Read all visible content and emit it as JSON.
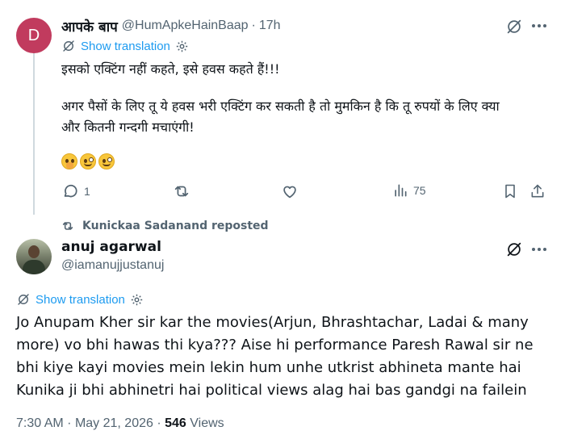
{
  "tweet1": {
    "avatar_initial": "D",
    "avatar_color": "#c13b5e",
    "name": "आपके बाप",
    "handle": "@HumApkeHainBaap",
    "separator": "·",
    "time": "17h",
    "show_translation": "Show translation",
    "lines": [
      "इसको एक्टिंग नहीं कहते, इसे हवस कहते हैं!!!",
      "अगर पैसों के लिए तू ये हवस भरी एक्टिंग कर सकती है तो मुमकिन है कि तू रुपयों के लिए क्या",
      "और कितनी गन्दगी मचाएंगी!"
    ],
    "emojis": [
      "hand-over-mouth-emoji",
      "zany-face-emoji",
      "zany-face-emoji"
    ],
    "actions": {
      "reply_count": "1",
      "views_count": "75"
    }
  },
  "repost_label": "Kunickaa Sadanand reposted",
  "tweet2": {
    "name": "anuj agarwal",
    "handle": "@iamanujjustanuj",
    "show_translation": "Show translation",
    "text_lines": [
      "Jo Anupam Kher sir kar the movies(Arjun, Bhrashtachar, Ladai & many",
      "more) vo bhi hawas thi kya??? Aise hi performance Paresh Rawal sir ne",
      "bhi kiye kayi movies mein lekin hum unhe utkrist abhineta mante hai",
      "Kunika ji bhi abhinetri hai political views alag hai bas gandgi na failein"
    ],
    "time": "7:30 AM",
    "date": "May 21, 2026",
    "separator": "·",
    "views_count": "546",
    "views_label": "Views"
  },
  "colors": {
    "link": "#1d9bf0",
    "secondary_text": "#536471",
    "primary_text": "#0f1419",
    "thread_line": "#cfd9de"
  }
}
